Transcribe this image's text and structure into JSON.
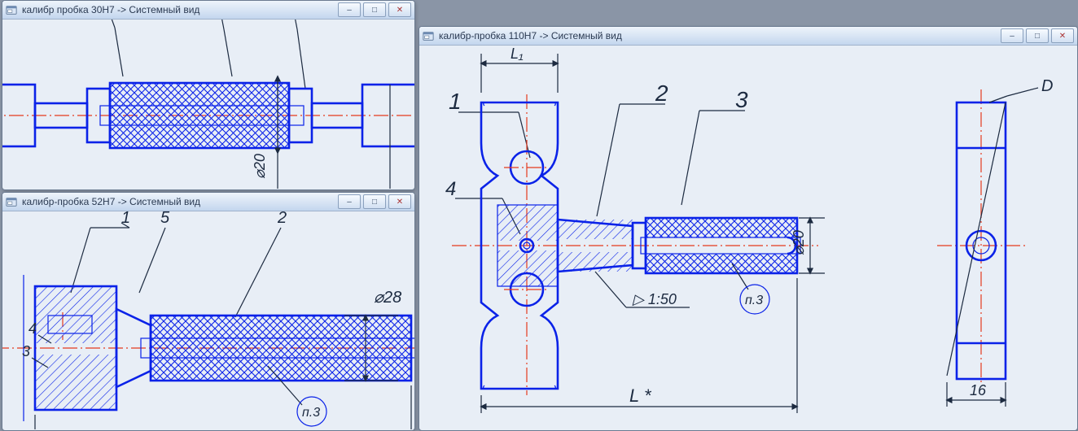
{
  "win30": {
    "title": "калибр пробка 30H7  -> Системный вид",
    "drawing": {
      "dia_label": "⌀20"
    },
    "buttons": {
      "min": "–",
      "max": "□",
      "close": "✕"
    }
  },
  "win52": {
    "title": "калибр-пробка 52H7  -> Системный вид",
    "drawing": {
      "dia_label": "⌀28",
      "balloon_1": "1",
      "balloon_2": "2",
      "balloon_3": "3",
      "balloon_4": "4",
      "balloon_5": "5",
      "balloon_n3": "п.3"
    },
    "buttons": {
      "min": "–",
      "max": "□",
      "close": "✕"
    }
  },
  "win110": {
    "title": "калибр-пробка 110H7  -> Системный вид",
    "drawing": {
      "dim_top": "L₁",
      "dim_bot": "L *",
      "dia_label": "⌀20",
      "taper": "▷ 1:50",
      "balloon_1": "1",
      "balloon_2": "2",
      "balloon_3": "3",
      "balloon_4": "4",
      "balloon_n3": "п.3",
      "side_angle": "D",
      "side_dim": "16"
    },
    "buttons": {
      "min": "–",
      "max": "□",
      "close": "✕"
    }
  }
}
